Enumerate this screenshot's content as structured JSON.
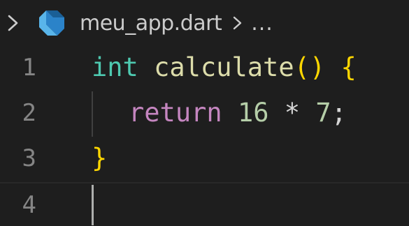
{
  "breadcrumb": {
    "file_name": "meu_app.dart",
    "more": "..."
  },
  "editor": {
    "line_numbers": [
      "1",
      "2",
      "3",
      "4"
    ],
    "line1": {
      "type_kw": "int",
      "func_name": "calculate",
      "paren_open": "(",
      "paren_close": ")",
      "brace_open": "{"
    },
    "line2": {
      "return_kw": "return",
      "num1": "16",
      "operator": "*",
      "num2": "7",
      "semicolon": ";"
    },
    "line3": {
      "brace_close": "}"
    }
  },
  "colors": {
    "background": "#1e1e1e",
    "type_keyword": "#4ec9b0",
    "function": "#dcdcaa",
    "bracket": "#ffd700",
    "control_keyword": "#c586c0",
    "number": "#b5cea8",
    "dart_icon": "#2b83c9"
  }
}
